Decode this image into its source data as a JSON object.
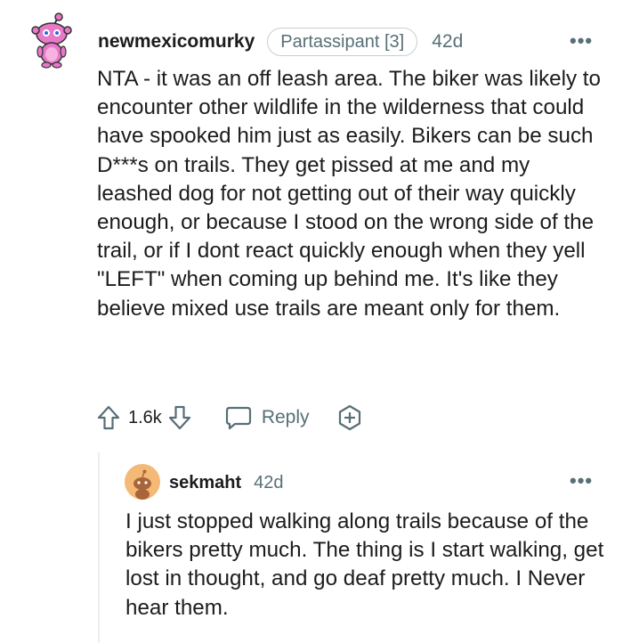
{
  "comment": {
    "username": "newmexicomurky",
    "flair": "Partassipant [3]",
    "age": "42d",
    "more_label": "•••",
    "avatar_icon": "snoo-avatar-pink-icon",
    "body": "NTA - it was an off leash area. The biker was likely to encounter other wildlife in the wilderness that could have spooked him just as easily. Bikers can be such D***s on trails. They get pissed at me and my leashed dog for not getting out of their way quickly enough, or because I stood on the wrong side of the trail, or if I dont react quickly enough when they yell \"LEFT\" when coming up behind me. It's like they believe mixed use trails are meant only for them.",
    "actions": {
      "vote_count": "1.6k",
      "reply_label": "Reply",
      "upvote_icon": "upvote-arrow-icon",
      "downvote_icon": "downvote-arrow-icon",
      "reply_icon": "speech-bubble-icon",
      "award_icon": "add-award-icon"
    }
  },
  "reply": {
    "username": "sekmaht",
    "age": "42d",
    "more_label": "•••",
    "avatar_icon": "snoo-avatar-orange-icon",
    "body": "I just stopped walking along trails because of the bikers pretty much. The thing is I start walking, get lost in thought, and go deaf pretty much. I Never hear them."
  },
  "colors": {
    "text": "#1c1c1c",
    "meta": "#576f76",
    "flair_border": "#c9ced3",
    "avatar_main": "#e879c8",
    "avatar_reply_bg": "#f4b977"
  }
}
